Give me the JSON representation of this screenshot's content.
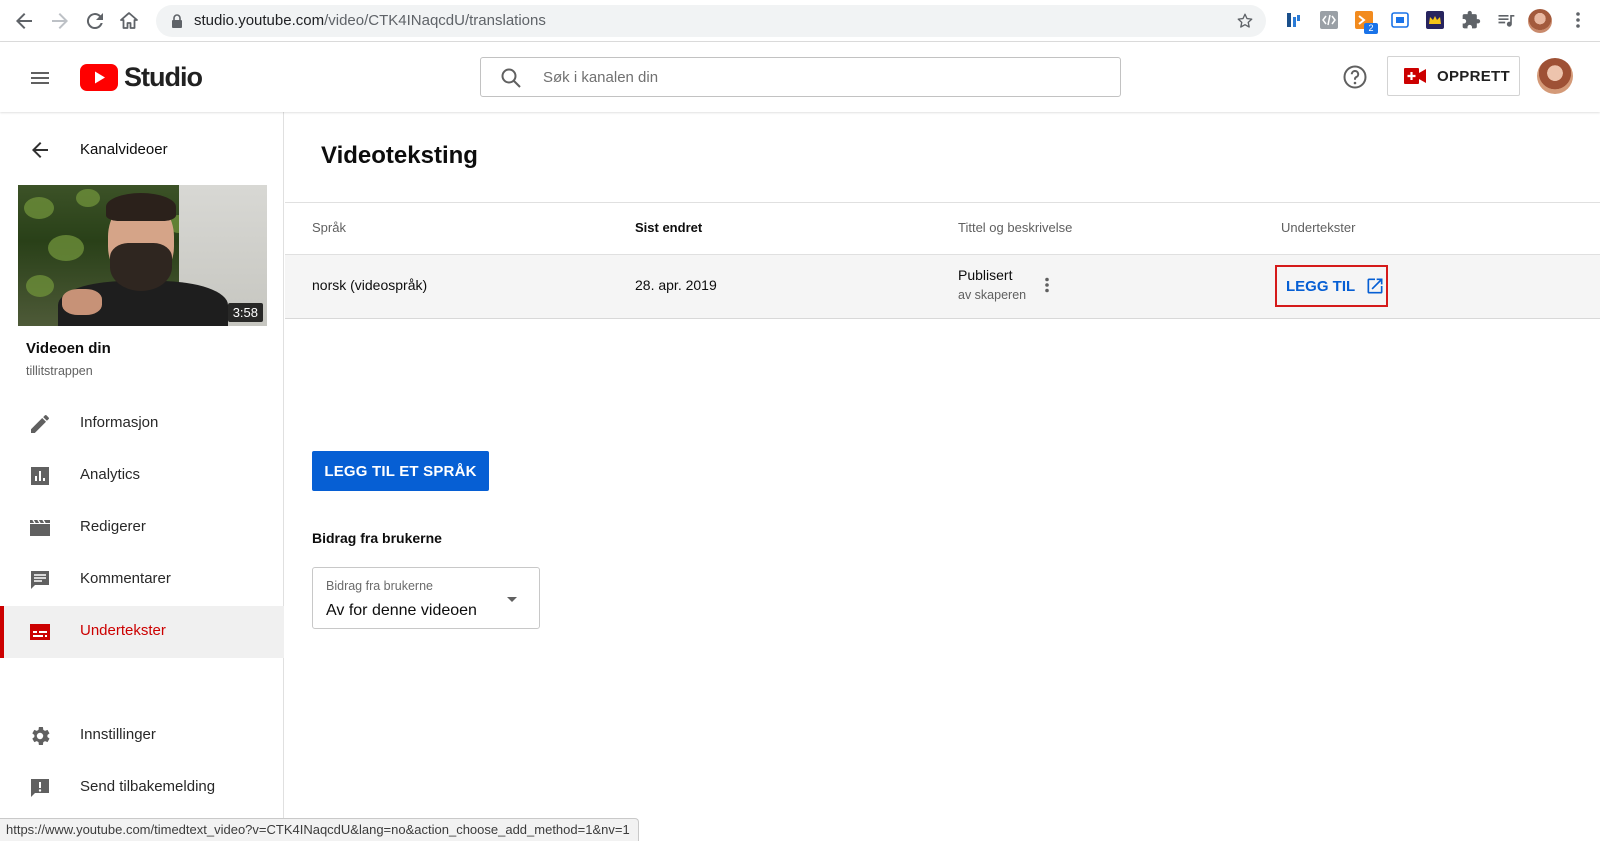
{
  "browser": {
    "url_host": "studio.youtube.com",
    "url_path": "/video/CTK4INaqcdU/translations",
    "extension_badge": "2"
  },
  "header": {
    "logo_text": "Studio",
    "search_placeholder": "Søk i kanalen din",
    "create_label": "OPPRETT"
  },
  "sidebar": {
    "back_label": "Kanalvideoer",
    "video": {
      "duration": "3:58",
      "title": "Videoen din",
      "channel": "tillitstrappen"
    },
    "items": [
      {
        "label": "Informasjon",
        "icon": "pencil-icon",
        "active": false
      },
      {
        "label": "Analytics",
        "icon": "analytics-icon",
        "active": false
      },
      {
        "label": "Redigerer",
        "icon": "clapperboard-icon",
        "active": false
      },
      {
        "label": "Kommentarer",
        "icon": "comment-icon",
        "active": false
      },
      {
        "label": "Undertekster",
        "icon": "subtitles-icon",
        "active": true
      },
      {
        "label": "Innstillinger",
        "icon": "gear-icon",
        "active": false
      },
      {
        "label": "Send tilbakemelding",
        "icon": "feedback-icon",
        "active": false
      }
    ]
  },
  "main": {
    "title": "Videoteksting",
    "table": {
      "columns": [
        "Språk",
        "Sist endret",
        "Tittel og beskrivelse",
        "Undertekster"
      ],
      "rows": [
        {
          "language": "norsk (videospråk)",
          "modified": "28. apr. 2019",
          "status": "Publisert",
          "status_sub": "av skaperen",
          "subtitles_action": "LEGG TIL"
        }
      ]
    },
    "add_language_button": "LEGG TIL ET SPRÅK",
    "contributions": {
      "heading": "Bidrag fra brukerne",
      "select_label": "Bidrag fra brukerne",
      "select_value": "Av for denne videoen"
    }
  },
  "status_bar": {
    "url": "https://www.youtube.com/timedtext_video?v=CTK4INaqcdU&lang=no&action_choose_add_method=1&nv=1"
  },
  "colors": {
    "brand_red": "#ff0000",
    "active_red": "#cc0000",
    "link_blue": "#065fd4",
    "highlight_box": "#d51a1a"
  }
}
